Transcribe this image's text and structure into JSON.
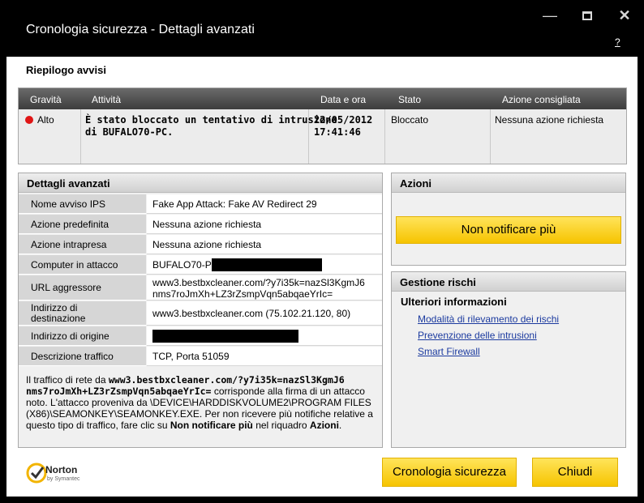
{
  "window": {
    "title": "Cronologia sicurezza - Dettagli avanzati",
    "help_label": "?"
  },
  "summary": {
    "section_title": "Riepilogo avvisi",
    "columns": [
      "Gravità",
      "Attività",
      "Data e ora",
      "Stato",
      "Azione consigliata"
    ],
    "row": {
      "severity": "Alto",
      "activity_line1": "È stato bloccato un tentativo di intrusione",
      "activity_line2": "di BUFALO70-PC.",
      "date": "22/05/2012",
      "time": "17:41:46",
      "status": "Bloccato",
      "recommended_action": "Nessuna azione richiesta"
    }
  },
  "details": {
    "title": "Dettagli avanzati",
    "rows": [
      {
        "label": "Nome avviso IPS",
        "value": "Fake App Attack: Fake AV Redirect 29"
      },
      {
        "label": "Azione predefinita",
        "value": "Nessuna azione richiesta"
      },
      {
        "label": "Azione intrapresa",
        "value": "Nessuna azione richiesta"
      },
      {
        "label": "Computer in attacco",
        "value": "BUFALO70-PC"
      },
      {
        "label": "URL aggressore",
        "value_line1": "www3.bestbxcleaner.com/?y7i35k=nazSl3KgmJ6",
        "value_line2": "nms7roJmXh+LZ3rZsmpVqn5abqaeYrIc="
      },
      {
        "label_line1": "Indirizzo di",
        "label_line2": "destinazione",
        "value": "www3.bestbxcleaner.com (75.102.21.120, 80)"
      },
      {
        "label": "Indirizzo di origine",
        "value": ""
      },
      {
        "label": "Descrizione traffico",
        "value": "TCP, Porta 51059"
      }
    ],
    "description": {
      "p1": "Il traffico di rete da ",
      "url_bold_line1": "www3.bestbxcleaner.com/?y7i35k=nazSl3KgmJ6",
      "url_bold_line2": "nms7roJmXh+LZ3rZsmpVqn5abqaeYrIc=",
      "p2": " corrisponde alla firma di un attacco noto. L'attacco proveniva da \\DEVICE\\HARDDISKVOLUME2\\PROGRAM FILES (X86)\\SEAMONKEY\\SEAMONKEY.EXE. Per non ricevere più notifiche relative a questo tipo di traffico, fare clic su ",
      "bold1": "Non notificare più",
      "p3": " nel riquadro ",
      "bold2": "Azioni",
      "p4": "."
    }
  },
  "actions": {
    "title": "Azioni",
    "button_label": "Non notificare più"
  },
  "risk": {
    "title": "Gestione rischi",
    "subtitle": "Ulteriori informazioni",
    "links": [
      "Modalità di rilevamento dei rischi",
      "Prevenzione delle intrusioni",
      "Smart Firewall"
    ]
  },
  "footer": {
    "logo_text": "Norton",
    "logo_sub": "by Symantec",
    "history_button": "Cronologia sicurezza",
    "close_button": "Chiudi"
  },
  "colors": {
    "accent_yellow": "#f6c400",
    "severity_red": "#e01515",
    "link_blue": "#1b3a9f"
  }
}
